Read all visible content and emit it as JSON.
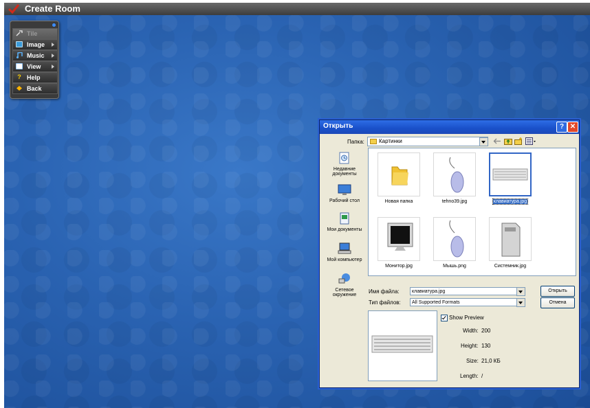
{
  "app": {
    "title": "Create Room"
  },
  "menu": {
    "items": [
      {
        "label": "Tile",
        "disabled": true,
        "icon": "tools-icon",
        "has_submenu": false
      },
      {
        "label": "Image",
        "icon": "image-icon",
        "has_submenu": true
      },
      {
        "label": "Music",
        "icon": "music-icon",
        "has_submenu": true
      },
      {
        "label": "View",
        "icon": "view-icon",
        "has_submenu": true
      },
      {
        "label": "Help",
        "icon": "help-icon",
        "has_submenu": false
      },
      {
        "label": "Back",
        "icon": "back-icon",
        "has_submenu": false
      }
    ]
  },
  "dialog": {
    "title": "Открыть",
    "lookin_label": "Папка:",
    "lookin_value": "Картинки",
    "places": [
      {
        "label": "Недавние документы",
        "icon": "recent-documents-icon"
      },
      {
        "label": "Рабочий стол",
        "icon": "desktop-icon"
      },
      {
        "label": "Мои документы",
        "icon": "my-documents-icon"
      },
      {
        "label": "Мой компьютер",
        "icon": "my-computer-icon"
      },
      {
        "label": "Сетевое окружение",
        "icon": "network-icon"
      }
    ],
    "files": [
      {
        "name": "Новая папка",
        "icon": "folder-icon"
      },
      {
        "name": "tehno39.jpg",
        "icon": "mouse-thumbnail"
      },
      {
        "name": "клавиатура.jpg",
        "icon": "keyboard-thumbnail",
        "selected": true
      },
      {
        "name": "Монитор.jpg",
        "icon": "monitor-thumbnail"
      },
      {
        "name": "Мышь.png",
        "icon": "mouse-thumbnail"
      },
      {
        "name": "Системник.jpg",
        "icon": "computer-case-thumbnail"
      }
    ],
    "filename_label": "Имя файла:",
    "filename_value": "клавиатура.jpg",
    "filetype_label": "Тип файлов:",
    "filetype_value": "All Supported Formats",
    "open_button": "Открыть",
    "cancel_button": "Отмена",
    "show_preview_label": "Show Preview",
    "show_preview_checked": true,
    "info": {
      "width_label": "Width:",
      "width_value": "200",
      "height_label": "Height:",
      "height_value": "130",
      "size_label": "Size:",
      "size_value": "21,0 КБ",
      "length_label": "Length:",
      "length_value": "/"
    }
  },
  "colors": {
    "desktop_blue": "#2a63b2",
    "xp_title_blue": "#1950c9",
    "dialog_bg": "#ece9d8",
    "selection_blue": "#316ac5"
  }
}
